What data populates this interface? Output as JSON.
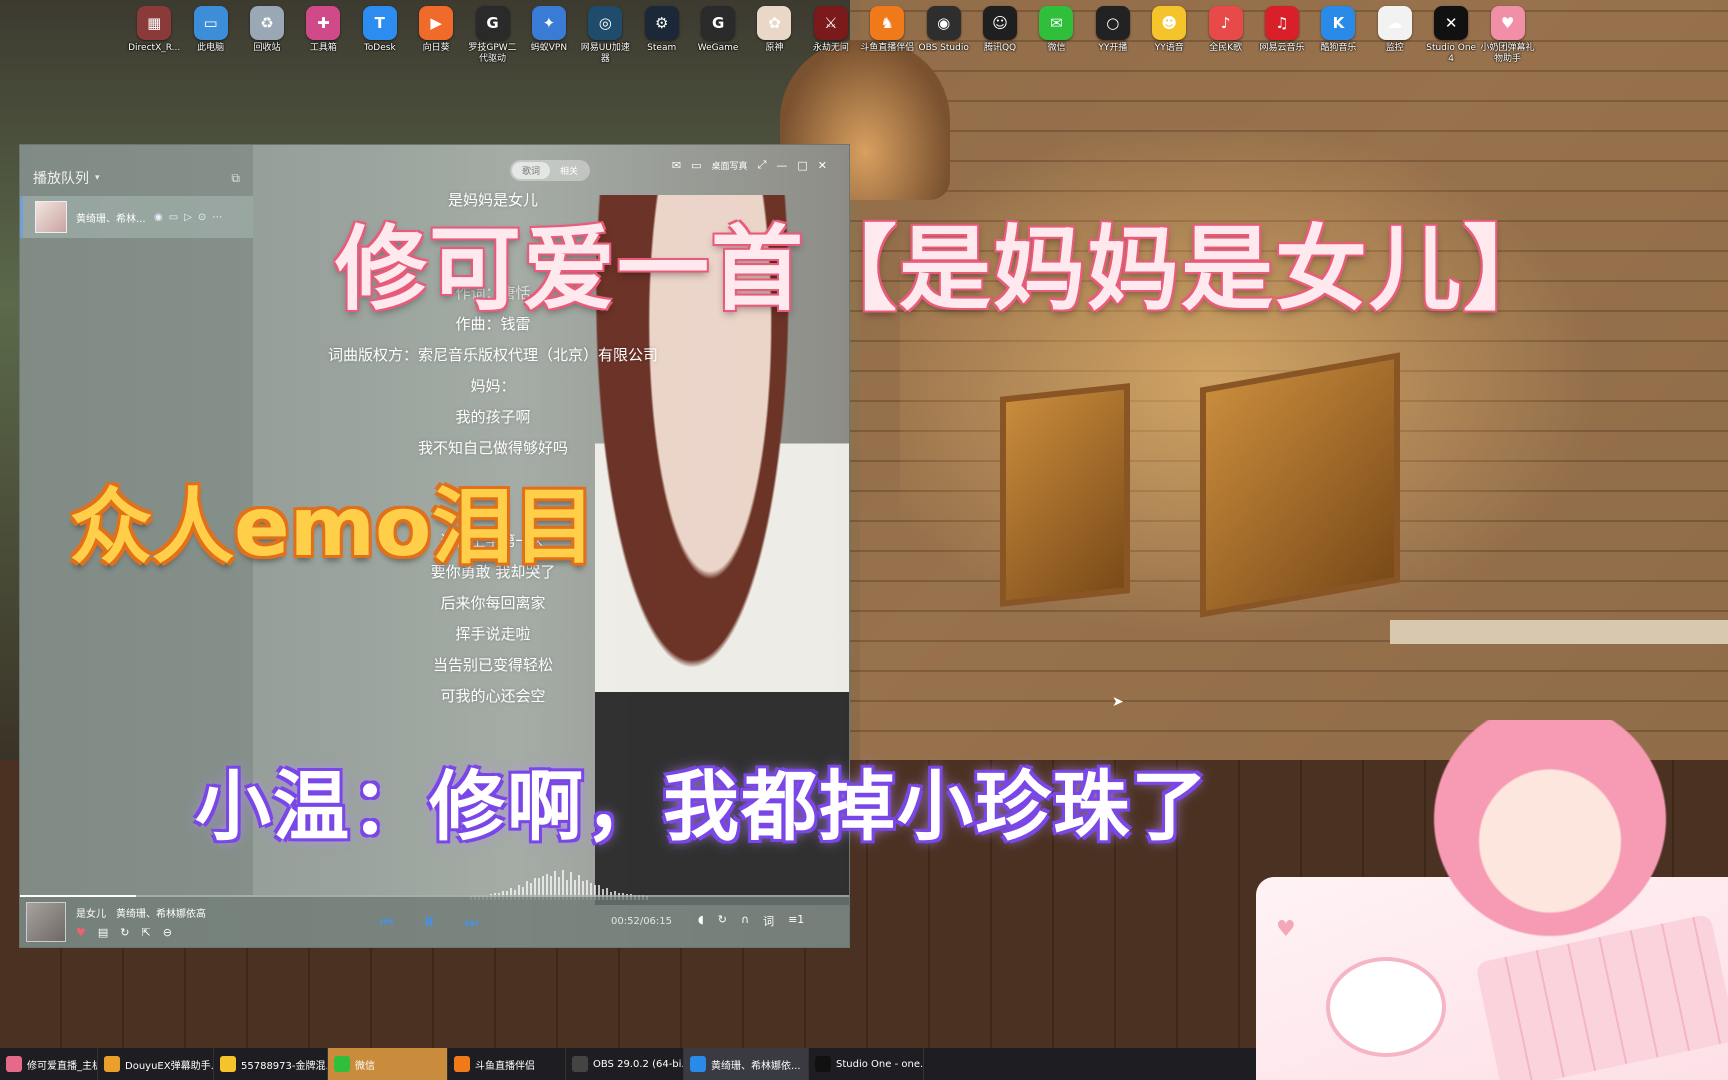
{
  "desktop_icons": [
    {
      "label": "DirectX_R...",
      "icon": "winrar-icon",
      "color": "#8b3a3a",
      "glyph": "▦"
    },
    {
      "label": "此电脑",
      "icon": "computer-icon",
      "color": "#3c8ed8",
      "glyph": "▭"
    },
    {
      "label": "回收站",
      "icon": "recycle-bin-icon",
      "color": "#9aa7b4",
      "glyph": "♻"
    },
    {
      "label": "工具箱",
      "icon": "toolbox-icon",
      "color": "#d04a8a",
      "glyph": "✚"
    },
    {
      "label": "ToDesk",
      "icon": "todesk-icon",
      "color": "#2d8cf0",
      "glyph": "T"
    },
    {
      "label": "向日葵",
      "icon": "sunflower-icon",
      "color": "#f06a2a",
      "glyph": "▶"
    },
    {
      "label": "罗技GPW二代驱动",
      "icon": "logitech-icon",
      "color": "#2a2a2a",
      "glyph": "G"
    },
    {
      "label": "蚂蚁VPN",
      "icon": "ant-vpn-icon",
      "color": "#3a7bd5",
      "glyph": "✦"
    },
    {
      "label": "网易UU加速器",
      "icon": "uu-accelerator-icon",
      "color": "#1f4c6b",
      "glyph": "◎"
    },
    {
      "label": "Steam",
      "icon": "steam-icon",
      "color": "#1b2838",
      "glyph": "⚙"
    },
    {
      "label": "WeGame",
      "icon": "wegame-icon",
      "color": "#2a2a2a",
      "glyph": "G"
    },
    {
      "label": "原神",
      "icon": "genshin-icon",
      "color": "#e9d8c8",
      "glyph": "✿"
    },
    {
      "label": "永劫无间",
      "icon": "naraka-icon",
      "color": "#7a1a1a",
      "glyph": "⚔"
    },
    {
      "label": "斗鱼直播伴侣",
      "icon": "douyu-icon",
      "color": "#f07a1a",
      "glyph": "♞"
    },
    {
      "label": "OBS Studio",
      "icon": "obs-icon",
      "color": "#2e2e2e",
      "glyph": "◉"
    },
    {
      "label": "腾讯QQ",
      "icon": "qq-icon",
      "color": "#1f1f1f",
      "glyph": "☺"
    },
    {
      "label": "微信",
      "icon": "wechat-icon",
      "color": "#2fbf3a",
      "glyph": "✉"
    },
    {
      "label": "YY开播",
      "icon": "yy-live-icon",
      "color": "#222",
      "glyph": "○"
    },
    {
      "label": "YY语音",
      "icon": "yy-voice-icon",
      "color": "#f5c32a",
      "glyph": "☻"
    },
    {
      "label": "全民K歌",
      "icon": "kge-icon",
      "color": "#e84a4a",
      "glyph": "♪"
    },
    {
      "label": "网易云音乐",
      "icon": "netease-music-icon",
      "color": "#d9202a",
      "glyph": "♫"
    },
    {
      "label": "酷狗音乐",
      "icon": "kugou-icon",
      "color": "#2a8ae8",
      "glyph": "K"
    },
    {
      "label": "监控",
      "icon": "cat-monitor-icon",
      "color": "#f2f2f2",
      "glyph": "☁"
    },
    {
      "label": "Studio One 4",
      "icon": "studio-one-icon",
      "color": "#111",
      "glyph": "✕"
    },
    {
      "label": "小奶团弹幕礼物助手",
      "icon": "danmaku-helper-icon",
      "color": "#f28fa8",
      "glyph": "♥"
    }
  ],
  "player": {
    "queue_title": "播放队列",
    "queue_item": "黄绮珊、希林...",
    "mode_tabs": [
      "歌词",
      "相关"
    ],
    "desktop_lyrics_label": "桌面写真",
    "lyrics": [
      "是妈妈是女儿",
      "",
      "",
      "作词：唐恬",
      "作曲：钱雷",
      "词曲版权方：索尼音乐版权代理（北京）有限公司",
      "妈妈：",
      "我的孩子啊",
      "我不知自己做得够好吗",
      "",
      "",
      "送你上学第一天",
      "要你勇敢 我却哭了",
      "后来你每回离家",
      "挥手说走啦",
      "当告别已变得轻松",
      "可我的心还会空"
    ],
    "now_playing": "是女儿　黄绮珊、希林娜依高",
    "time": "00:52/06:15",
    "progress": 0.14,
    "accent_color": "#4a90e2"
  },
  "overlays": {
    "title": "修可爱一首【是妈妈是女儿】",
    "emo": "众人emo泪目",
    "quote": "小温：修啊，我都掉小珍珠了"
  },
  "taskbar": [
    {
      "label": "修可爱直播_主机画...",
      "icon": "live-window-icon",
      "color": "#e56a8a"
    },
    {
      "label": "DouyuEX弹幕助手...",
      "icon": "chrome-icon",
      "color": "#e8a02a"
    },
    {
      "label": "55788973-金牌混...",
      "icon": "yy-voice-icon",
      "color": "#f5c32a"
    },
    {
      "label": "微信",
      "icon": "wechat-icon",
      "color": "#2fbf3a"
    },
    {
      "label": "斗鱼直播伴侣",
      "icon": "douyu-icon",
      "color": "#f07a1a"
    },
    {
      "label": "OBS 29.0.2 (64-bi...",
      "icon": "obs-icon",
      "color": "#444"
    },
    {
      "label": "黄绮珊、希林娜依...",
      "icon": "kugou-icon",
      "color": "#2a8ae8"
    },
    {
      "label": "Studio One - one...",
      "icon": "studio-one-icon",
      "color": "#111"
    }
  ]
}
